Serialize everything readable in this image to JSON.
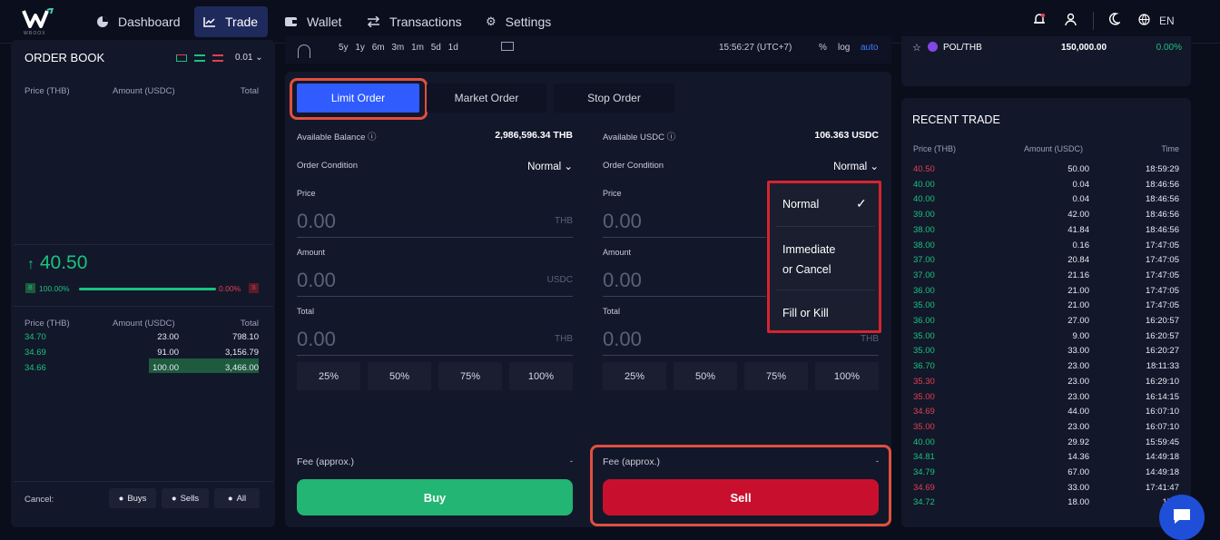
{
  "nav": {
    "logo_text": "W",
    "logo_sub": "WROOX",
    "items": [
      {
        "label": "Dashboard",
        "icon": "pie-chart-icon"
      },
      {
        "label": "Trade",
        "icon": "line-chart-icon"
      },
      {
        "label": "Wallet",
        "icon": "wallet-icon"
      },
      {
        "label": "Transactions",
        "icon": "swap-arrows-icon"
      },
      {
        "label": "Settings",
        "icon": "gear-icon"
      }
    ],
    "language": "EN"
  },
  "chart_toolbar": {
    "ranges": [
      "5y",
      "1y",
      "6m",
      "3m",
      "1m",
      "5d",
      "1d"
    ],
    "time": "15:56:27 (UTC+7)",
    "pct": "%",
    "log": "log",
    "auto": "auto"
  },
  "order_book": {
    "title": "ORDER BOOK",
    "precision": "0.01",
    "headers": [
      "Price (THB)",
      "Amount (USDC)",
      "Total"
    ],
    "last_price": "40.50",
    "buy_pct": "100.00%",
    "sell_pct": "0.00%",
    "buy_tag": "B",
    "sell_tag": "S",
    "bottom_headers": [
      "Price (THB)",
      "Amount (USDC)",
      "Total"
    ],
    "bids": [
      {
        "price": "34.70",
        "amount": "23.00",
        "total": "798.10"
      },
      {
        "price": "34.69",
        "amount": "91.00",
        "total": "3,156.79"
      },
      {
        "price": "34.66",
        "amount": "100.00",
        "total": "3,466.00"
      }
    ],
    "cancel_label": "Cancel:",
    "cancel_buys": "Buys",
    "cancel_sells": "Sells",
    "cancel_all": "All"
  },
  "order_form": {
    "tabs": [
      "Limit Order",
      "Market Order",
      "Stop Order"
    ],
    "buy": {
      "balance_label": "Available Balance",
      "balance_value": "2,986,596.34 THB",
      "condition_label": "Order Condition",
      "condition_value": "Normal",
      "price_label": "Price",
      "price_placeholder": "0.00",
      "price_unit": "THB",
      "amount_label": "Amount",
      "amount_placeholder": "0.00",
      "amount_unit": "USDC",
      "total_label": "Total",
      "total_placeholder": "0.00",
      "total_unit": "THB",
      "fee_label": "Fee (approx.)",
      "fee_value": "-",
      "button": "Buy"
    },
    "sell": {
      "balance_label": "Available USDC",
      "balance_value": "106.363 USDC",
      "condition_label": "Order Condition",
      "condition_value": "Normal",
      "price_label": "Price",
      "price_placeholder": "0.00",
      "amount_label": "Amount",
      "amount_placeholder": "0.00",
      "total_label": "Total",
      "total_placeholder": "0.00",
      "total_unit": "THB",
      "fee_label": "Fee (approx.)",
      "fee_value": "-",
      "button": "Sell"
    },
    "percent_buttons": [
      "25%",
      "50%",
      "75%",
      "100%"
    ]
  },
  "condition_dropdown": {
    "options": [
      "Normal",
      "Immediate\nor Cancel",
      "Fill or Kill"
    ],
    "selected": "Normal"
  },
  "market": {
    "pair": "POL/THB",
    "price": "150,000.00",
    "change": "0.00%"
  },
  "recent_trade": {
    "title": "RECENT TRADE",
    "headers": [
      "Price (THB)",
      "Amount (USDC)",
      "Time"
    ],
    "rows": [
      {
        "price": "40.50",
        "amount": "50.00",
        "time": "18:59:29",
        "side": "sell"
      },
      {
        "price": "40.00",
        "amount": "0.04",
        "time": "18:46:56",
        "side": "buy"
      },
      {
        "price": "40.00",
        "amount": "0.04",
        "time": "18:46:56",
        "side": "buy"
      },
      {
        "price": "39.00",
        "amount": "42.00",
        "time": "18:46:56",
        "side": "buy"
      },
      {
        "price": "38.00",
        "amount": "41.84",
        "time": "18:46:56",
        "side": "buy"
      },
      {
        "price": "38.00",
        "amount": "0.16",
        "time": "17:47:05",
        "side": "buy"
      },
      {
        "price": "37.00",
        "amount": "20.84",
        "time": "17:47:05",
        "side": "buy"
      },
      {
        "price": "37.00",
        "amount": "21.16",
        "time": "17:47:05",
        "side": "buy"
      },
      {
        "price": "36.00",
        "amount": "21.00",
        "time": "17:47:05",
        "side": "buy"
      },
      {
        "price": "35.00",
        "amount": "21.00",
        "time": "17:47:05",
        "side": "buy"
      },
      {
        "price": "36.00",
        "amount": "27.00",
        "time": "16:20:57",
        "side": "buy"
      },
      {
        "price": "35.00",
        "amount": "9.00",
        "time": "16:20:57",
        "side": "buy"
      },
      {
        "price": "35.00",
        "amount": "33.00",
        "time": "16:20:27",
        "side": "buy"
      },
      {
        "price": "36.70",
        "amount": "23.00",
        "time": "18:11:33",
        "side": "buy"
      },
      {
        "price": "35.30",
        "amount": "23.00",
        "time": "16:29:10",
        "side": "sell"
      },
      {
        "price": "35.00",
        "amount": "23.00",
        "time": "16:14:15",
        "side": "sell"
      },
      {
        "price": "34.69",
        "amount": "44.00",
        "time": "16:07:10",
        "side": "sell"
      },
      {
        "price": "35.00",
        "amount": "23.00",
        "time": "16:07:10",
        "side": "sell"
      },
      {
        "price": "40.00",
        "amount": "29.92",
        "time": "15:59:45",
        "side": "buy"
      },
      {
        "price": "34.81",
        "amount": "14.36",
        "time": "14:49:18",
        "side": "buy"
      },
      {
        "price": "34.79",
        "amount": "67.00",
        "time": "14:49:18",
        "side": "buy"
      },
      {
        "price": "34.69",
        "amount": "33.00",
        "time": "17:41:47",
        "side": "sell"
      },
      {
        "price": "34.72",
        "amount": "18.00",
        "time": "17:2",
        "side": "buy"
      }
    ]
  },
  "colors": {
    "accent": "#2f5bff",
    "buy": "#19c37d",
    "sell": "#c8102e",
    "highlight": "#e0503e"
  }
}
